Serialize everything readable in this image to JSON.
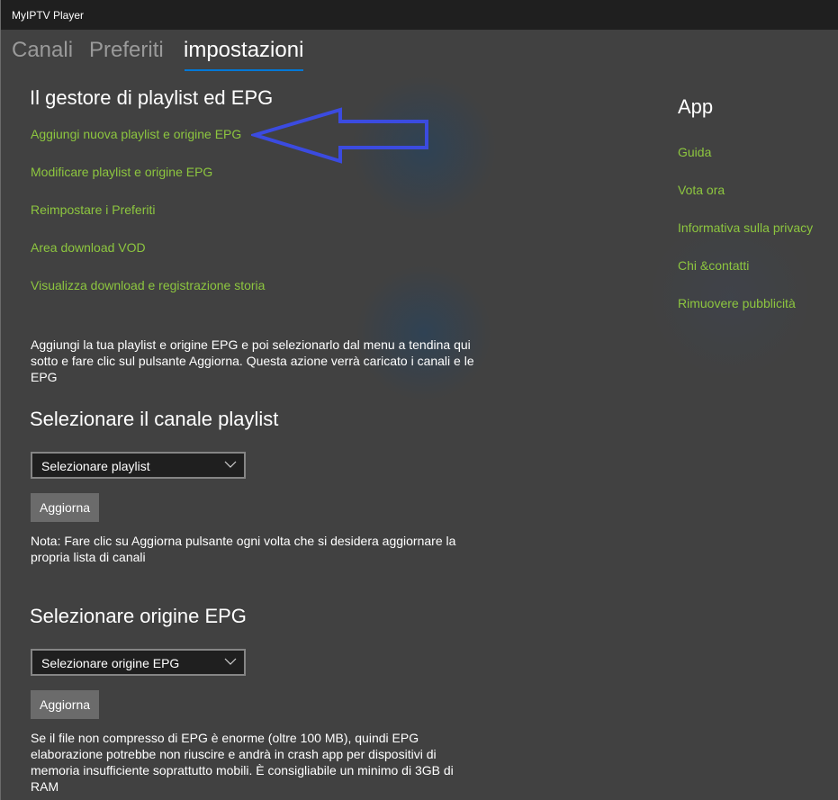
{
  "window": {
    "title": "MyIPTV Player"
  },
  "tabs": [
    {
      "label": "Canali",
      "active": false
    },
    {
      "label": "Preferiti",
      "active": false
    },
    {
      "label": "impostazioni",
      "active": true
    }
  ],
  "playlist_manager": {
    "heading": "Il gestore di playlist ed EPG",
    "links": [
      {
        "label": "Aggiungi nuova playlist e origine EPG"
      },
      {
        "label": "Modificare playlist e origine EPG"
      },
      {
        "label": "Reimpostare i Preferiti"
      },
      {
        "label": "Area download VOD"
      },
      {
        "label": "Visualizza download e registrazione storia"
      }
    ],
    "description": "Aggiungi la tua playlist e origine EPG e poi selezionarlo dal menu a tendina qui sotto e fare clic sul pulsante Aggiorna. Questa azione verrà caricato i canali e le EPG"
  },
  "annotation": {
    "arrow_icon": "arrow-left-icon",
    "arrow_color": "#3b4be0"
  },
  "playlist_section": {
    "heading": "Selezionare il canale playlist",
    "dropdown_value": "Selezionare playlist",
    "button_label": "Aggiorna",
    "note": "Nota: Fare clic su Aggiorna pulsante ogni volta che si desidera aggiornare la propria lista di canali"
  },
  "epg_section": {
    "heading": "Selezionare origine EPG",
    "dropdown_value": "Selezionare origine EPG",
    "button_label": "Aggiorna",
    "note": "Se il file non compresso di EPG è enorme (oltre 100 MB), quindi EPG elaborazione potrebbe non riuscire e andrà in crash app per dispositivi di memoria insufficiente soprattutto mobili. È consigliabile un minimo di 3GB di RAM"
  },
  "app_section": {
    "heading": "App",
    "links": [
      {
        "label": "Guida"
      },
      {
        "label": "Vota ora"
      },
      {
        "label": "Informativa sulla privacy"
      },
      {
        "label": "Chi &contatti"
      },
      {
        "label": "Rimuovere pubblicità"
      }
    ]
  },
  "colors": {
    "accent": "#0078d7",
    "link": "#8dc63f",
    "background": "#414141",
    "titlebar": "#1f1f1f"
  }
}
